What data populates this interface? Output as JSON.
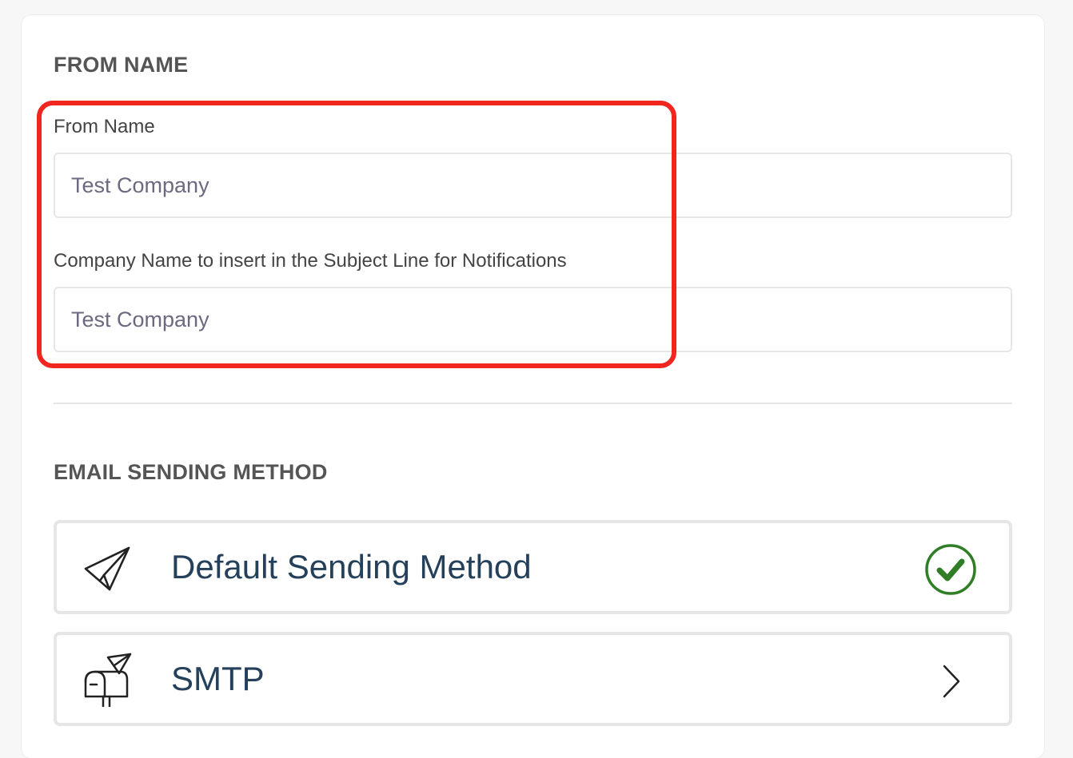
{
  "from_name_section": {
    "heading": "FROM NAME",
    "from_name_label": "From Name",
    "from_name_value": "Test Company",
    "subject_company_label": "Company Name to insert in the Subject Line for Notifications",
    "subject_company_value": "Test Company",
    "highlight_color": "#f0261f"
  },
  "sending_method_section": {
    "heading": "EMAIL SENDING METHOD",
    "options": [
      {
        "label": "Default Sending Method",
        "icon": "paper-plane-icon",
        "status": "selected",
        "status_icon": "check-circle-icon"
      },
      {
        "label": "SMTP",
        "icon": "mailbox-icon",
        "status": "navigate",
        "status_icon": "chevron-right-icon"
      }
    ],
    "label_color": "#24405a",
    "check_color": "#2f7d25"
  }
}
